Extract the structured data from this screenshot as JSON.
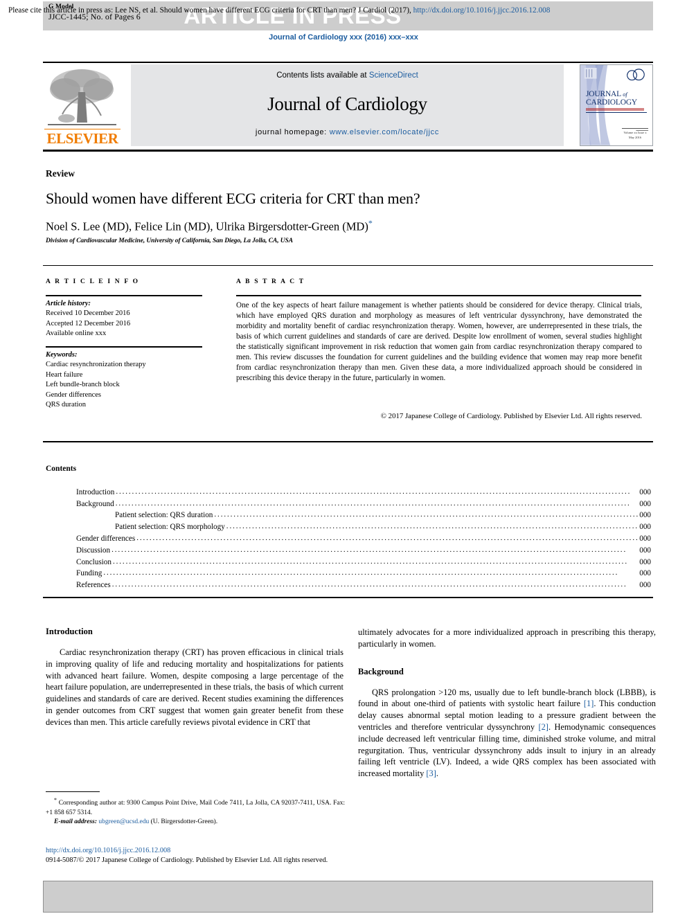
{
  "header": {
    "g_model_label": "G Model",
    "manuscript_id": "JJCC-1445; No. of Pages 6",
    "status_banner": "ARTICLE IN PRESS",
    "journal_ref": "Journal of Cardiology xxx (2016) xxx–xxx",
    "band_color": "#cdcdcd",
    "link_color": "#1a5b9e"
  },
  "masthead": {
    "publisher_logo_text": "ELSEVIER",
    "publisher_color": "#f07c00",
    "contents_prefix": "Contents lists available at ",
    "contents_link": "ScienceDirect",
    "journal_title": "Journal of Cardiology",
    "homepage_prefix": "journal homepage: ",
    "homepage_url": "www.elsevier.com/locate/jjcc",
    "cover": {
      "line1": "JOURNAL",
      "of": "of",
      "line2": "CARDIOLOGY",
      "volume_note": "Volume xx Issue x\nMay 2016"
    }
  },
  "article": {
    "kicker": "Review",
    "title": "Should women have different ECG criteria for CRT than men?",
    "authors": "Noel S. Lee (MD), Felice Lin (MD), Ulrika Birgersdotter-Green (MD)",
    "author_marker": "*",
    "affiliation": "Division of Cardiovascular Medicine, University of California, San Diego, La Jolla, CA, USA"
  },
  "article_info": {
    "heading": "A R T I C L E   I N F O",
    "history_label": "Article history:",
    "history": [
      "Received 10 December 2016",
      "Accepted 12 December 2016",
      "Available online xxx"
    ],
    "keywords_label": "Keywords:",
    "keywords": [
      "Cardiac resynchronization therapy",
      "Heart failure",
      "Left bundle-branch block",
      "Gender differences",
      "QRS duration"
    ]
  },
  "abstract": {
    "heading": "A B S T R A C T",
    "body": "One of the key aspects of heart failure management is whether patients should be considered for device therapy. Clinical trials, which have employed QRS duration and morphology as measures of left ventricular dyssynchrony, have demonstrated the morbidity and mortality benefit of cardiac resynchronization therapy. Women, however, are underrepresented in these trials, the basis of which current guidelines and standards of care are derived. Despite low enrollment of women, several studies highlight the statistically significant improvement in risk reduction that women gain from cardiac resynchronization therapy compared to men. This review discusses the foundation for current guidelines and the building evidence that women may reap more benefit from cardiac resynchronization therapy than men. Given these data, a more individualized approach should be considered in prescribing this device therapy in the future, particularly in women.",
    "copyright": "© 2017 Japanese College of Cardiology. Published by Elsevier Ltd. All rights reserved."
  },
  "contents": {
    "heading": "Contents",
    "entries": [
      {
        "label": "Introduction",
        "page": "000",
        "indent": false
      },
      {
        "label": "Background",
        "page": "000",
        "indent": false
      },
      {
        "label": "Patient selection: QRS duration",
        "page": "000",
        "indent": true
      },
      {
        "label": "Patient selection: QRS morphology",
        "page": "000",
        "indent": true
      },
      {
        "label": "Gender differences",
        "page": "000",
        "indent": false
      },
      {
        "label": "Discussion",
        "page": "000",
        "indent": false
      },
      {
        "label": "Conclusion",
        "page": "000",
        "indent": false
      },
      {
        "label": "Funding",
        "page": "000",
        "indent": false
      },
      {
        "label": "References",
        "page": "000",
        "indent": false
      }
    ],
    "dot_leader": "................................................................................................................................................................"
  },
  "body": {
    "left": {
      "intro_heading": "Introduction",
      "intro_para": "Cardiac resynchronization therapy (CRT) has proven efficacious in clinical trials in improving quality of life and reducing mortality and hospitalizations for patients with advanced heart failure. Women, despite composing a large percentage of the heart failure population, are underrepresented in these trials, the basis of which current guidelines and standards of care are derived. Recent studies examining the differences in gender outcomes from CRT suggest that women gain greater benefit from these devices than men. This article carefully reviews pivotal evidence in CRT that"
    },
    "right": {
      "intro_continued": "ultimately advocates for a more individualized approach in prescribing this therapy, particularly in women.",
      "background_heading": "Background",
      "background_p1_a": "QRS prolongation >120 ms, usually due to left bundle-branch block (LBBB), is found in about one-third of patients with systolic heart failure ",
      "background_ref1": "[1]",
      "background_p1_b": ". This conduction delay causes abnormal septal motion leading to a pressure gradient between the ventricles and therefore ventricular dyssynchrony ",
      "background_ref2": "[2]",
      "background_p1_c": ". Hemodynamic consequences include decreased left ventricular filling time, diminished stroke volume, and mitral regurgitation. Thus, ventricular dyssynchrony adds insult to injury in an already failing left ventricle (LV). Indeed, a wide QRS complex has been associated with increased mortality ",
      "background_ref3": "[3]",
      "background_p1_d": "."
    }
  },
  "footnotes": {
    "corresponding_marker": "*",
    "corresponding": " Corresponding author at: 9300 Campus Point Drive, Mail Code 7411, La Jolla, CA 92037-7411, USA. Fax: +1 858 657 5314.",
    "email_label": "E-mail address:",
    "email": "ubgreen@ucsd.edu",
    "email_owner": " (U. Birgersdotter-Green).",
    "doi_url": "http://dx.doi.org/10.1016/j.jjcc.2016.12.008",
    "issn_line": "0914-5087/© 2017 Japanese College of Cardiology. Published by Elsevier Ltd. All rights reserved."
  },
  "citation_footer": {
    "text_a": "Please cite this article in press as: Lee NS, et al. Should women have different ECG criteria for CRT than men? J Cardiol (2017), ",
    "link": "http://dx.doi.org/10.1016/j.jjcc.2016.12.008"
  }
}
